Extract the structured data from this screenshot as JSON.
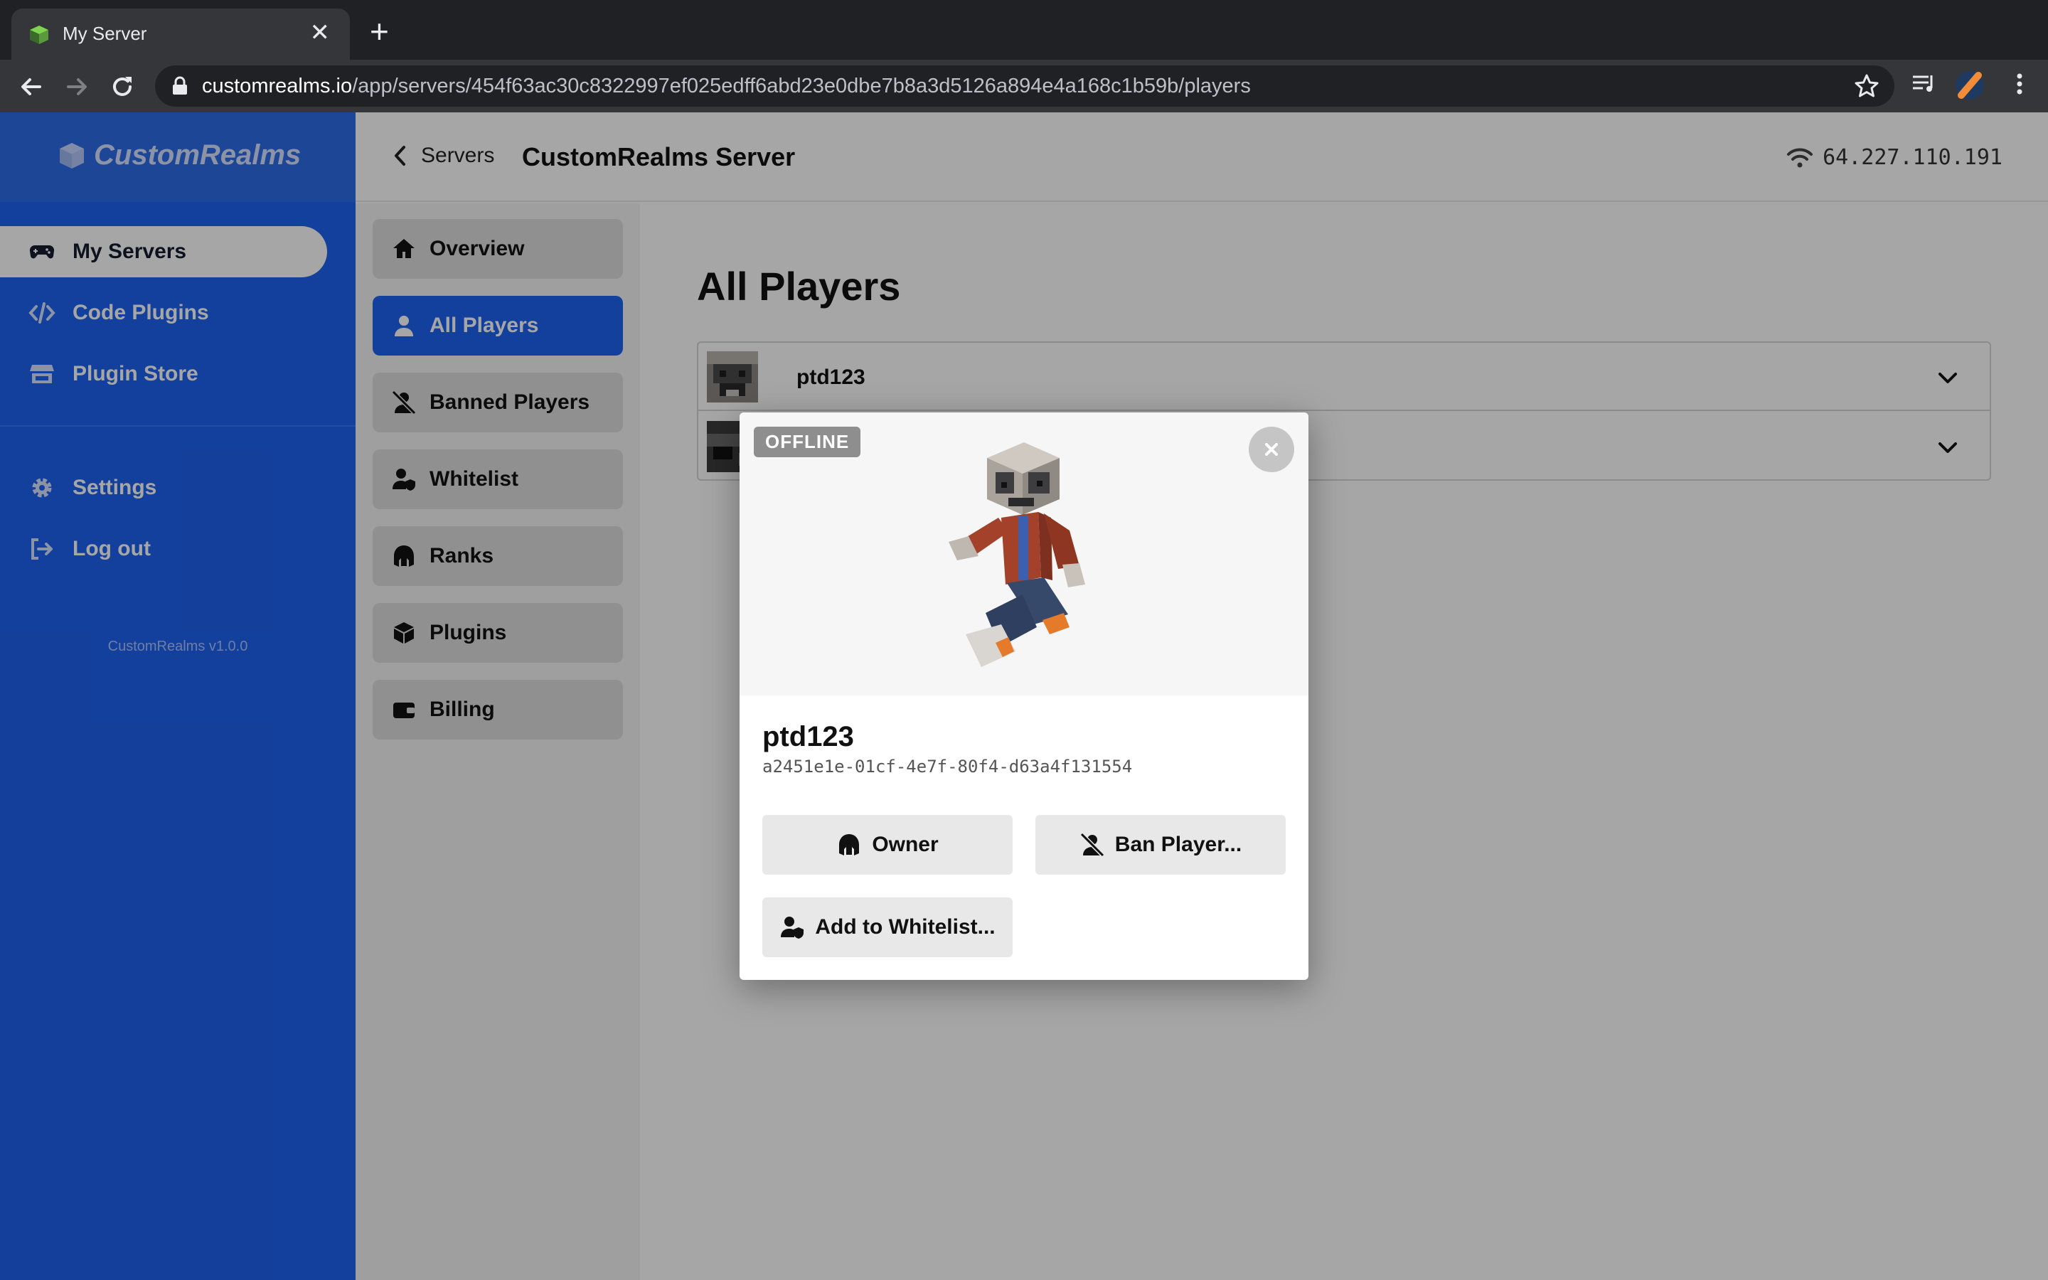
{
  "browser": {
    "tab_title": "My Server",
    "tab_close_glyph": "✕",
    "new_tab_glyph": "+",
    "url_host": "customrealms.io",
    "url_path": "/app/servers/454f63ac30c8322997ef025edff6abd23e0dbe7b8a3d5126a894e4a168c1b59b/players"
  },
  "sidebar": {
    "logo_text": "CustomRealms",
    "items": [
      {
        "label": "My Servers",
        "icon": "gamepad-icon",
        "active": true
      },
      {
        "label": "Code Plugins",
        "icon": "code-icon",
        "active": false
      },
      {
        "label": "Plugin Store",
        "icon": "store-icon",
        "active": false
      }
    ],
    "secondary_items": [
      {
        "label": "Settings",
        "icon": "gear-icon"
      },
      {
        "label": "Log out",
        "icon": "logout-icon"
      }
    ],
    "version": "CustomRealms v1.0.0"
  },
  "topbar": {
    "back_label": "Servers",
    "server_title": "CustomRealms Server",
    "ip": "64.227.110.191"
  },
  "subnav": {
    "items": [
      {
        "label": "Overview",
        "icon": "home-icon",
        "active": false
      },
      {
        "label": "All Players",
        "icon": "user-icon",
        "active": true
      },
      {
        "label": "Banned Players",
        "icon": "user-slash-icon",
        "active": false
      },
      {
        "label": "Whitelist",
        "icon": "user-shield-icon",
        "active": false
      },
      {
        "label": "Ranks",
        "icon": "helmet-icon",
        "active": false
      },
      {
        "label": "Plugins",
        "icon": "cube-icon",
        "active": false
      },
      {
        "label": "Billing",
        "icon": "wallet-icon",
        "active": false
      }
    ]
  },
  "main": {
    "heading": "All Players",
    "players": [
      {
        "name": "ptd123"
      },
      {
        "name": ""
      }
    ]
  },
  "modal": {
    "status": "OFFLINE",
    "player_name": "ptd123",
    "uuid": "a2451e1e-01cf-4e7f-80f4-d63a4f131554",
    "owner_label": "Owner",
    "ban_label": "Ban Player...",
    "whitelist_label": "Add to Whitelist..."
  },
  "colors": {
    "brand_blue": "#1e63f0",
    "overlay": "rgba(0,0,0,0.35)",
    "badge_gray": "#8e8e8e"
  }
}
